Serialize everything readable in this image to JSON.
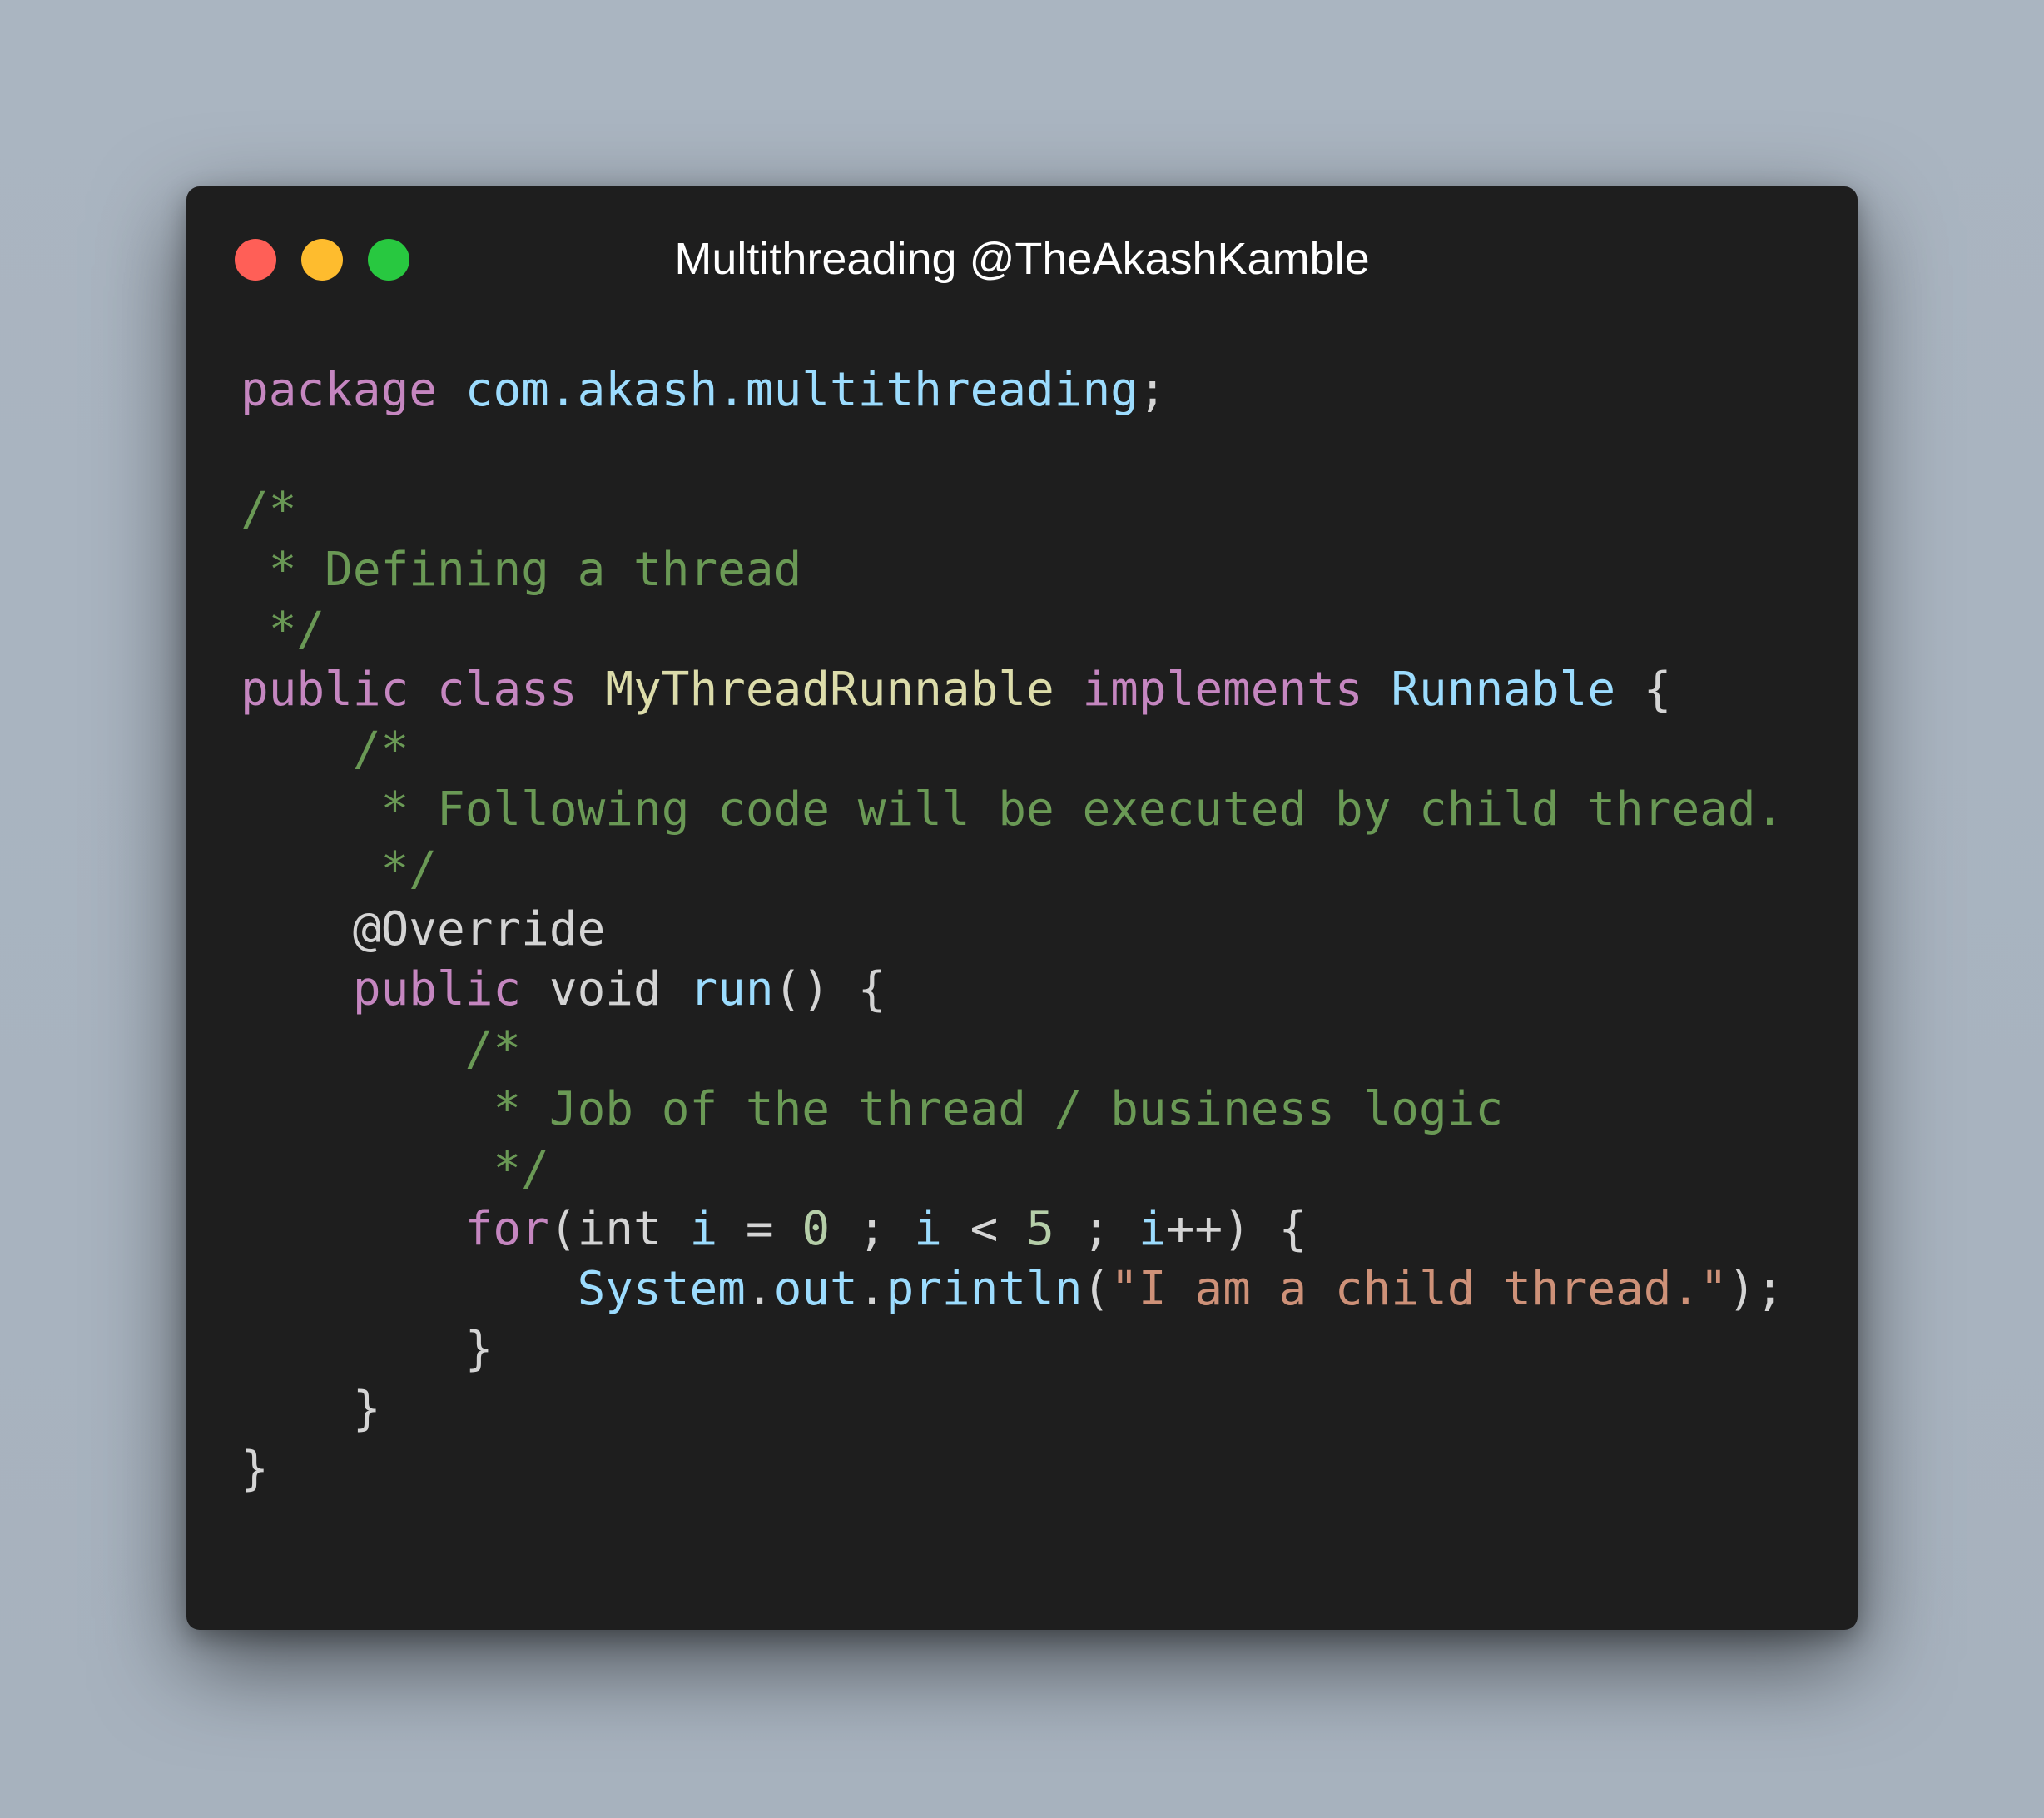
{
  "window": {
    "title": "Multithreading @TheAkashKamble",
    "controls": {
      "close": "red-circle",
      "minimize": "yellow-circle",
      "maximize": "green-circle"
    },
    "colors": {
      "background": "#1e1e1e",
      "close": "#ff5f57",
      "minimize": "#febc2e",
      "maximize": "#28c840"
    }
  },
  "code": {
    "language": "java",
    "lines": [
      [
        {
          "text": "package",
          "type": "keyword"
        },
        {
          "text": " ",
          "type": "plain"
        },
        {
          "text": "com.akash.multithreading",
          "type": "package"
        },
        {
          "text": ";",
          "type": "punc"
        }
      ],
      [],
      [
        {
          "text": "/*",
          "type": "comment"
        }
      ],
      [
        {
          "text": " * Defining a thread",
          "type": "comment"
        }
      ],
      [
        {
          "text": " */",
          "type": "comment"
        }
      ],
      [
        {
          "text": "public",
          "type": "keyword"
        },
        {
          "text": " ",
          "type": "plain"
        },
        {
          "text": "class",
          "type": "keyword"
        },
        {
          "text": " ",
          "type": "plain"
        },
        {
          "text": "MyThreadRunnable",
          "type": "class"
        },
        {
          "text": " ",
          "type": "plain"
        },
        {
          "text": "implements",
          "type": "keyword"
        },
        {
          "text": " ",
          "type": "plain"
        },
        {
          "text": "Runnable",
          "type": "type"
        },
        {
          "text": " {",
          "type": "punc"
        }
      ],
      [
        {
          "text": "    ",
          "type": "plain"
        },
        {
          "text": "/*",
          "type": "comment"
        }
      ],
      [
        {
          "text": "    ",
          "type": "plain"
        },
        {
          "text": " * Following code will be executed by child thread.",
          "type": "comment"
        }
      ],
      [
        {
          "text": "    ",
          "type": "plain"
        },
        {
          "text": " */",
          "type": "comment"
        }
      ],
      [
        {
          "text": "    ",
          "type": "plain"
        },
        {
          "text": "@Override",
          "type": "annotation"
        }
      ],
      [
        {
          "text": "    ",
          "type": "plain"
        },
        {
          "text": "public",
          "type": "keyword"
        },
        {
          "text": " void ",
          "type": "plain"
        },
        {
          "text": "run",
          "type": "method"
        },
        {
          "text": "() {",
          "type": "punc"
        }
      ],
      [
        {
          "text": "        ",
          "type": "plain"
        },
        {
          "text": "/*",
          "type": "comment"
        }
      ],
      [
        {
          "text": "        ",
          "type": "plain"
        },
        {
          "text": " * Job of the thread / business logic",
          "type": "comment"
        }
      ],
      [
        {
          "text": "        ",
          "type": "plain"
        },
        {
          "text": " */",
          "type": "comment"
        }
      ],
      [
        {
          "text": "        ",
          "type": "plain"
        },
        {
          "text": "for",
          "type": "keyword"
        },
        {
          "text": "(int ",
          "type": "plain"
        },
        {
          "text": "i",
          "type": "var"
        },
        {
          "text": " = ",
          "type": "plain"
        },
        {
          "text": "0",
          "type": "number"
        },
        {
          "text": " ; ",
          "type": "plain"
        },
        {
          "text": "i",
          "type": "var"
        },
        {
          "text": " < ",
          "type": "plain"
        },
        {
          "text": "5",
          "type": "number"
        },
        {
          "text": " ; ",
          "type": "plain"
        },
        {
          "text": "i",
          "type": "var"
        },
        {
          "text": "++) {",
          "type": "plain"
        }
      ],
      [
        {
          "text": "            ",
          "type": "plain"
        },
        {
          "text": "System",
          "type": "type"
        },
        {
          "text": ".",
          "type": "punc"
        },
        {
          "text": "out",
          "type": "var"
        },
        {
          "text": ".",
          "type": "punc"
        },
        {
          "text": "println",
          "type": "method"
        },
        {
          "text": "(",
          "type": "punc"
        },
        {
          "text": "\"I am a child thread.\"",
          "type": "string"
        },
        {
          "text": ");",
          "type": "punc"
        }
      ],
      [
        {
          "text": "        }",
          "type": "punc"
        }
      ],
      [
        {
          "text": "    }",
          "type": "punc"
        }
      ],
      [
        {
          "text": "}",
          "type": "punc"
        }
      ]
    ]
  }
}
